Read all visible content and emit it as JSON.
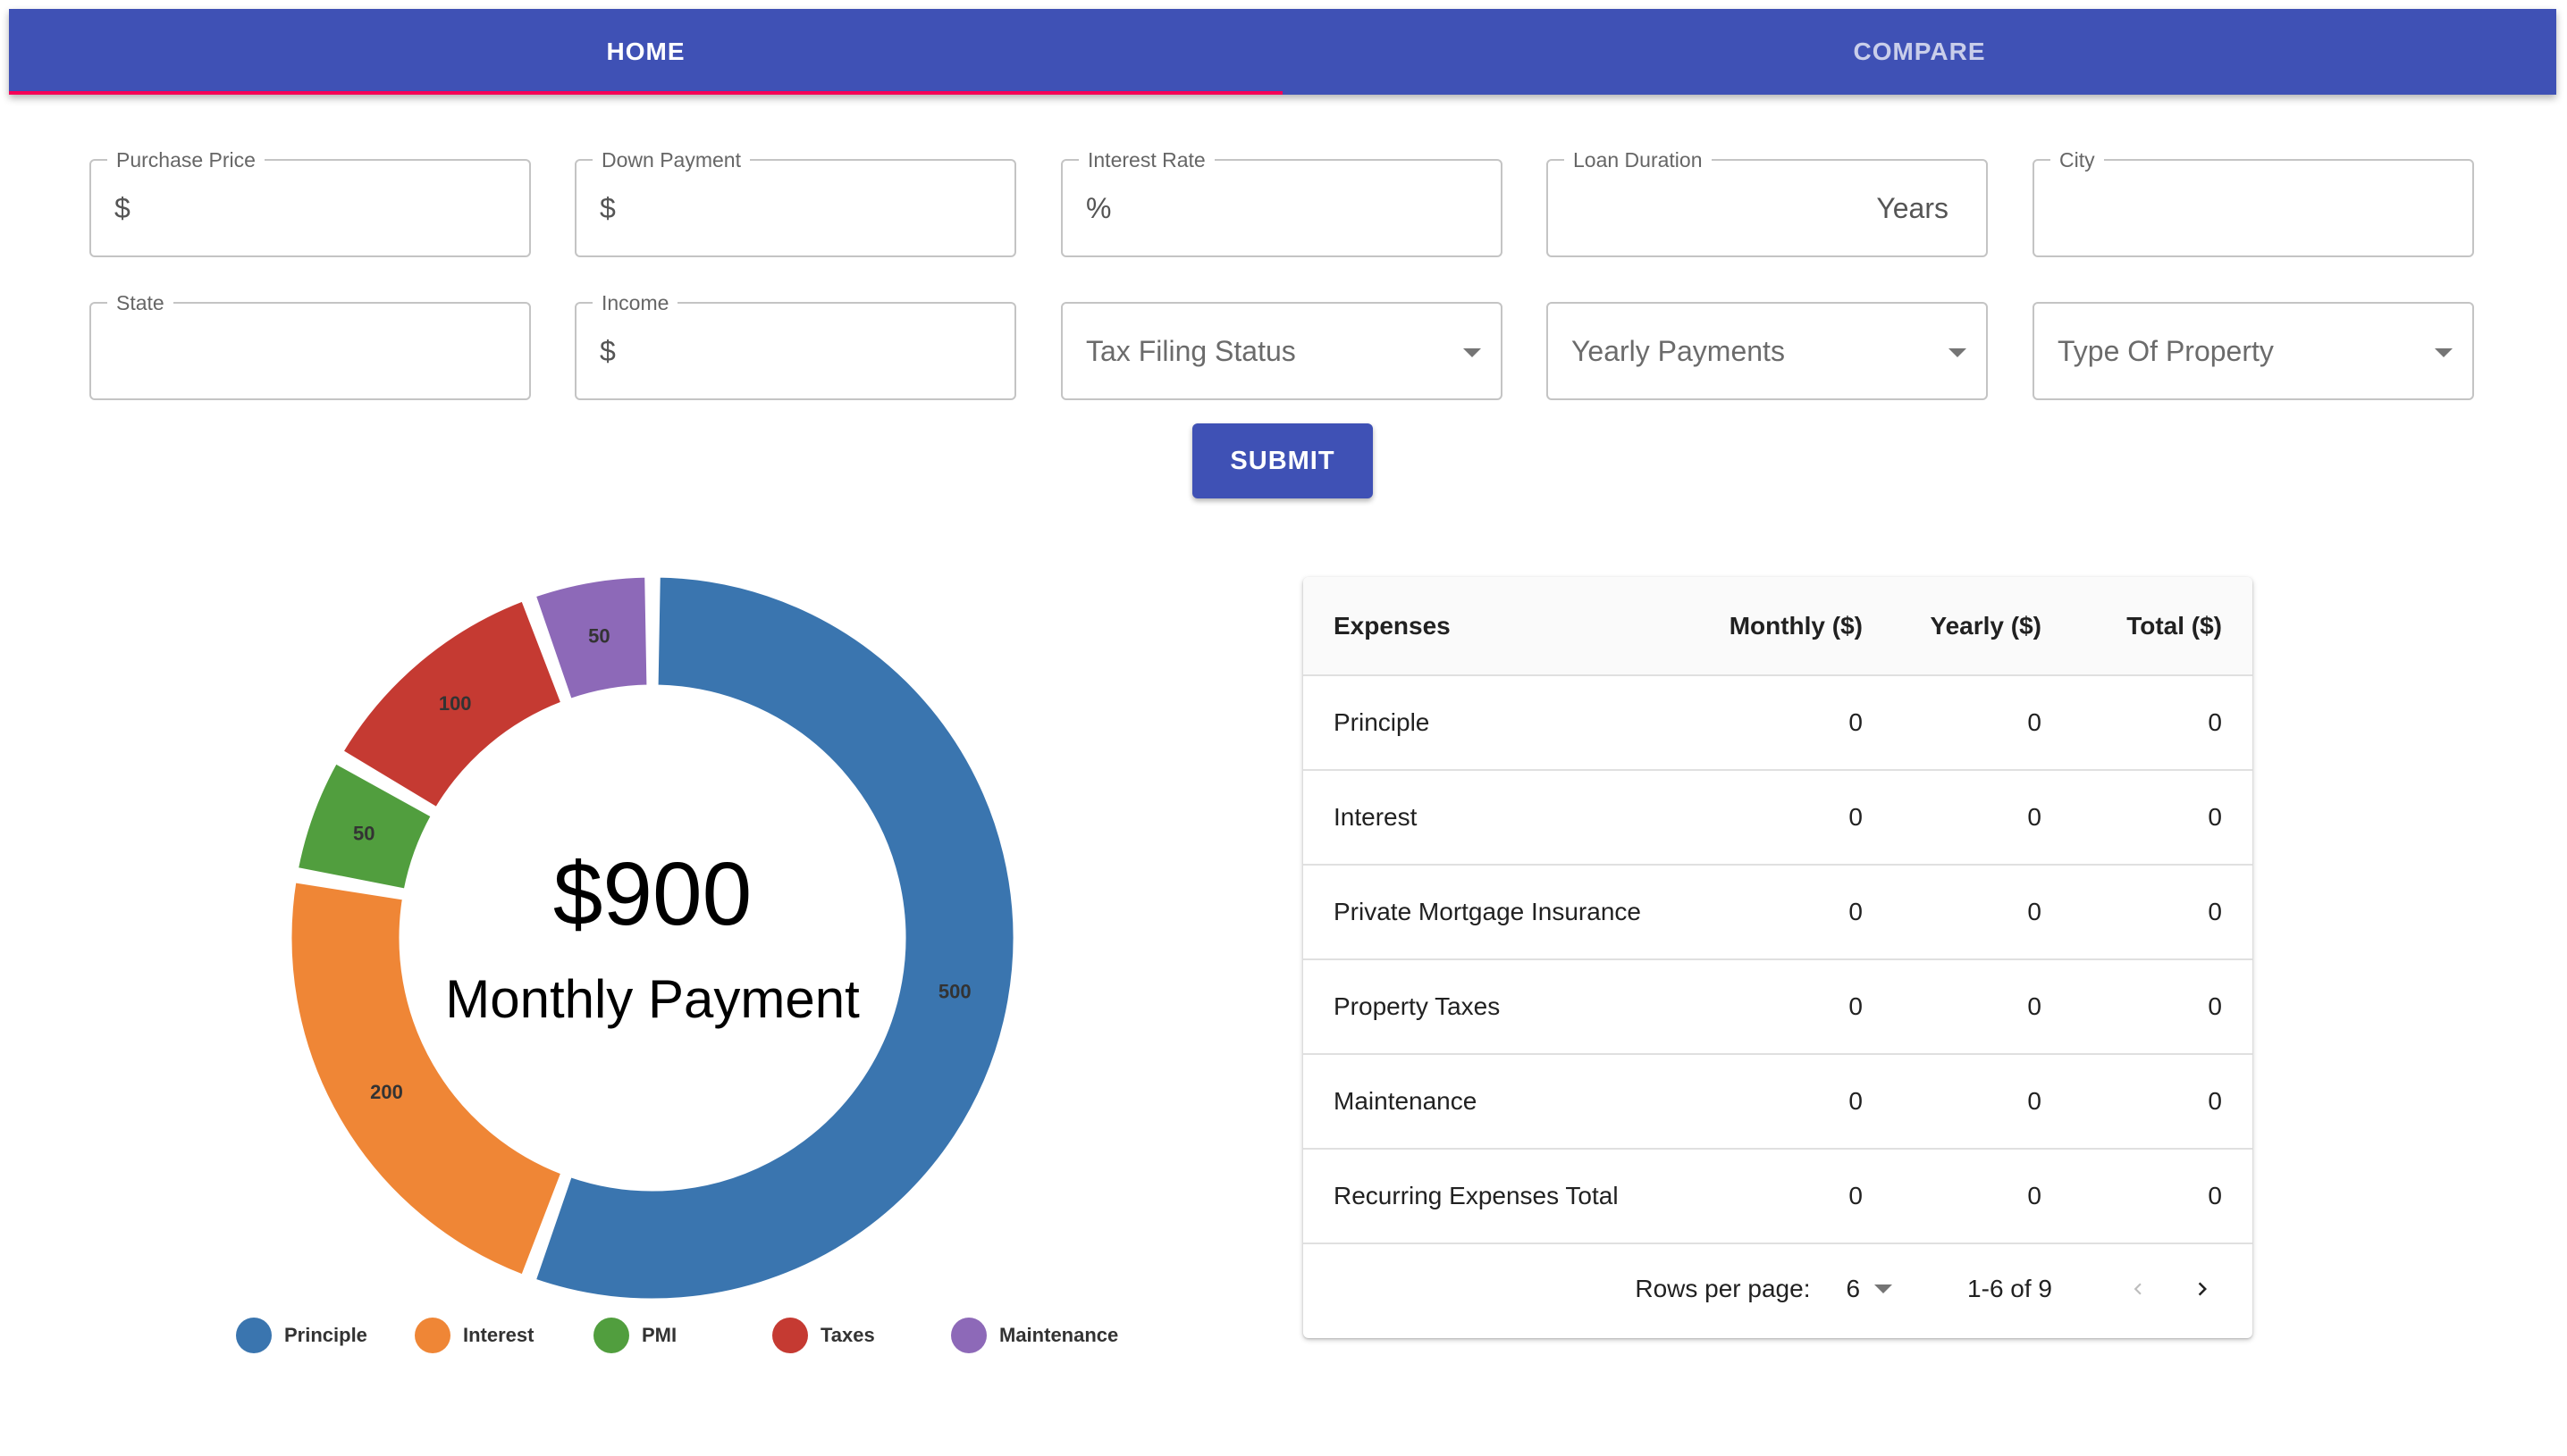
{
  "tabs": [
    {
      "label": "HOME",
      "active": true
    },
    {
      "label": "COMPARE",
      "active": false
    }
  ],
  "accent_colors": {
    "primary": "#3f51b5",
    "indicator": "#f50057"
  },
  "form": {
    "purchase_price": {
      "label": "Purchase Price",
      "adornment": "$",
      "value": ""
    },
    "down_payment": {
      "label": "Down Payment",
      "adornment": "$",
      "value": ""
    },
    "interest_rate": {
      "label": "Interest Rate",
      "adornment": "%",
      "value": ""
    },
    "loan_duration": {
      "label": "Loan Duration",
      "adornment": "Years",
      "value": ""
    },
    "city": {
      "label": "City",
      "value": ""
    },
    "state": {
      "label": "State",
      "value": ""
    },
    "income": {
      "label": "Income",
      "adornment": "$",
      "value": ""
    },
    "tax_filing_status": {
      "label": "Tax Filing Status",
      "value": ""
    },
    "yearly_payments": {
      "label": "Yearly Payments",
      "value": ""
    },
    "type_of_property": {
      "label": "Type Of Property",
      "value": ""
    },
    "submit_label": "SUBMIT"
  },
  "chart_center": {
    "amount": "$900",
    "caption": "Monthly Payment"
  },
  "chart_data": {
    "type": "pie",
    "variant": "donut",
    "title": "",
    "categories": [
      "Principle",
      "Interest",
      "PMI",
      "Taxes",
      "Maintenance"
    ],
    "values": [
      500,
      200,
      50,
      100,
      50
    ],
    "colors": [
      "#3a75af",
      "#ef8636",
      "#519e3e",
      "#c53a32",
      "#8d69b8"
    ],
    "legend_position": "bottom"
  },
  "table": {
    "headers": [
      "Expenses",
      "Monthly ($)",
      "Yearly ($)",
      "Total ($)"
    ],
    "rows": [
      [
        "Principle",
        "0",
        "0",
        "0"
      ],
      [
        "Interest",
        "0",
        "0",
        "0"
      ],
      [
        "Private Mortgage Insurance",
        "0",
        "0",
        "0"
      ],
      [
        "Property Taxes",
        "0",
        "0",
        "0"
      ],
      [
        "Maintenance",
        "0",
        "0",
        "0"
      ],
      [
        "Recurring Expenses Total",
        "0",
        "0",
        "0"
      ]
    ],
    "pagination": {
      "rows_per_page_label": "Rows per page:",
      "rows_per_page": "6",
      "range": "1-6 of 9"
    }
  }
}
